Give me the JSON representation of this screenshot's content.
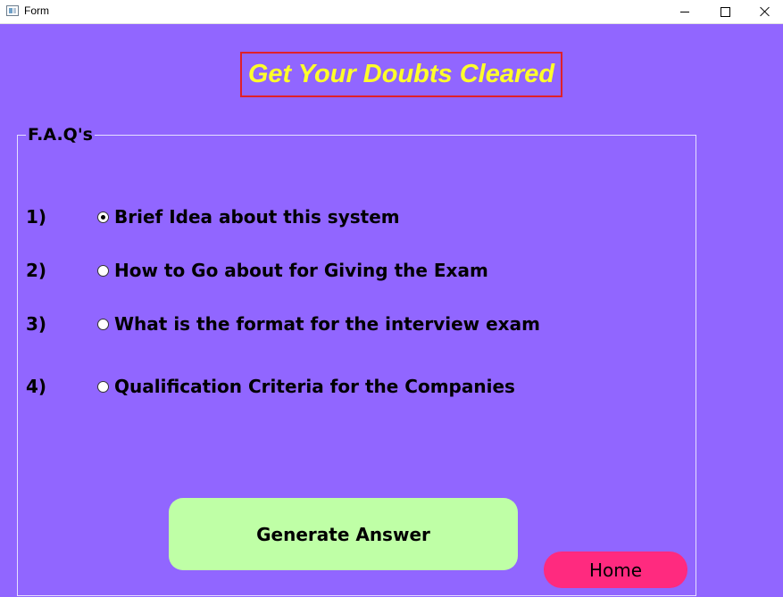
{
  "window": {
    "title": "Form",
    "icons": [
      "app-icon",
      "minimize-icon",
      "maximize-icon",
      "close-icon"
    ]
  },
  "heading": {
    "text": "Get Your Doubts Cleared",
    "text_color": "#ffff2a",
    "border_color": "#e0202a"
  },
  "faq_group": {
    "legend": "F.A.Q's",
    "items": [
      {
        "number": "1)",
        "label": "Brief Idea about this system",
        "selected": true
      },
      {
        "number": "2)",
        "label": "How to Go about for Giving the Exam",
        "selected": false
      },
      {
        "number": "3)",
        "label": "What is the format for the interview exam",
        "selected": false
      },
      {
        "number": "4)",
        "label": "Qualification Criteria for the Companies",
        "selected": false
      }
    ]
  },
  "buttons": {
    "generate_label": "Generate Answer",
    "generate_color": "#bfffa6",
    "home_label": "Home",
    "home_color": "#ff2a7f"
  },
  "colors": {
    "background": "#9166ff"
  }
}
